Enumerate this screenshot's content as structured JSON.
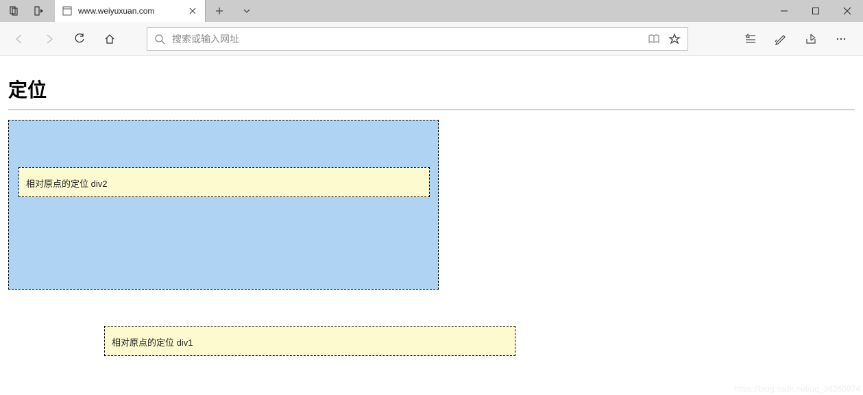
{
  "titlebar": {
    "tab_title": "www.weiyuxuan.com"
  },
  "toolbar": {
    "address_placeholder": "搜索或输入网址"
  },
  "page": {
    "heading": "定位",
    "div2_text": "相对原点的定位 div2",
    "div1_text": "相对原点的定位 div1"
  },
  "watermark": "https://blog.csdn.net/qq_36260974"
}
